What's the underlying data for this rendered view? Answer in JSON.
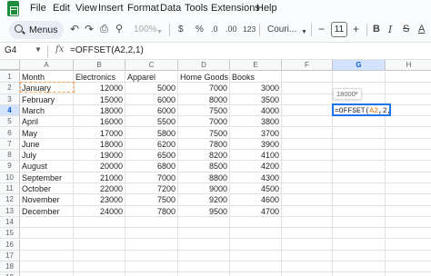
{
  "menubar": {
    "items": [
      "File",
      "Edit",
      "View",
      "Insert",
      "Format",
      "Data",
      "Tools",
      "Extensions",
      "Help"
    ]
  },
  "toolbar": {
    "menus_label": "Menus",
    "zoom": "100%",
    "currency": "$",
    "percent": "%",
    "decrease_decimal": ".0",
    "increase_decimal": ".00",
    "number_format": "123",
    "font_name": "Couri...",
    "font_size": "11",
    "font_size_minus": "−",
    "font_size_plus": "+"
  },
  "formula_bar": {
    "name_box": "G4",
    "fx": "fx",
    "formula": "=OFFSET(A2,2,1)"
  },
  "columns": [
    "A",
    "B",
    "C",
    "D",
    "E",
    "F",
    "G",
    "H"
  ],
  "rows": [
    "1",
    "2",
    "3",
    "4",
    "5",
    "6",
    "7",
    "8",
    "9",
    "10",
    "11",
    "12",
    "13",
    "14",
    "15",
    "16",
    "17",
    "18",
    "19"
  ],
  "headers": [
    "Month",
    "Electronics",
    "Apparel",
    "Home Goods",
    "Books"
  ],
  "data_rows": [
    [
      "January",
      "12000",
      "5000",
      "7000",
      "3000"
    ],
    [
      "February",
      "15000",
      "6000",
      "8000",
      "3500"
    ],
    [
      "March",
      "18000",
      "6000",
      "7500",
      "4000"
    ],
    [
      "April",
      "16000",
      "5500",
      "7000",
      "3800"
    ],
    [
      "May",
      "17000",
      "5800",
      "7500",
      "3700"
    ],
    [
      "June",
      "18000",
      "6200",
      "7800",
      "3900"
    ],
    [
      "July",
      "19000",
      "6500",
      "8200",
      "4100"
    ],
    [
      "August",
      "20000",
      "6800",
      "8500",
      "4200"
    ],
    [
      "September",
      "21000",
      "7000",
      "8800",
      "4300"
    ],
    [
      "October",
      "22000",
      "7200",
      "9000",
      "4500"
    ],
    [
      "November",
      "23000",
      "7500",
      "9200",
      "4600"
    ],
    [
      "December",
      "24000",
      "7800",
      "9500",
      "4700"
    ]
  ],
  "active_cell": {
    "column": "G",
    "row": "4",
    "formula_prefix": "=OFFSET(",
    "formula_ref": "A2",
    "formula_suffix": ",2,1)"
  },
  "preview_chip": {
    "value": "18000",
    "close": "×"
  },
  "colors": {
    "accent": "#1a73e8",
    "copy_border": "#f0a050",
    "ref_color": "#e37400",
    "header_active": "#d3e3fd"
  }
}
